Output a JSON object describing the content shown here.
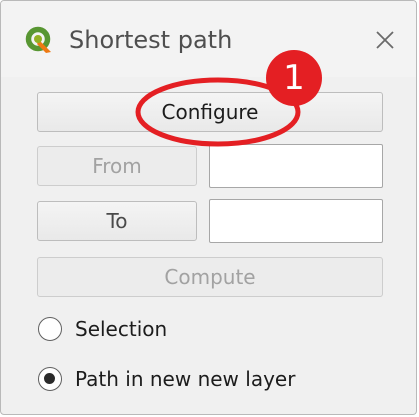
{
  "window": {
    "title": "Shortest path",
    "app_icon": "qgis-icon",
    "close_icon": "close-icon"
  },
  "buttons": {
    "configure": "Configure",
    "from": "From",
    "to": "To",
    "compute": "Compute"
  },
  "inputs": {
    "from_value": "",
    "to_value": ""
  },
  "options": {
    "selection_label": "Selection",
    "path_label": "Path in new new layer",
    "selected": "Path in new new layer"
  },
  "annotation": {
    "badge_number": "1",
    "color": "#e41f23"
  }
}
